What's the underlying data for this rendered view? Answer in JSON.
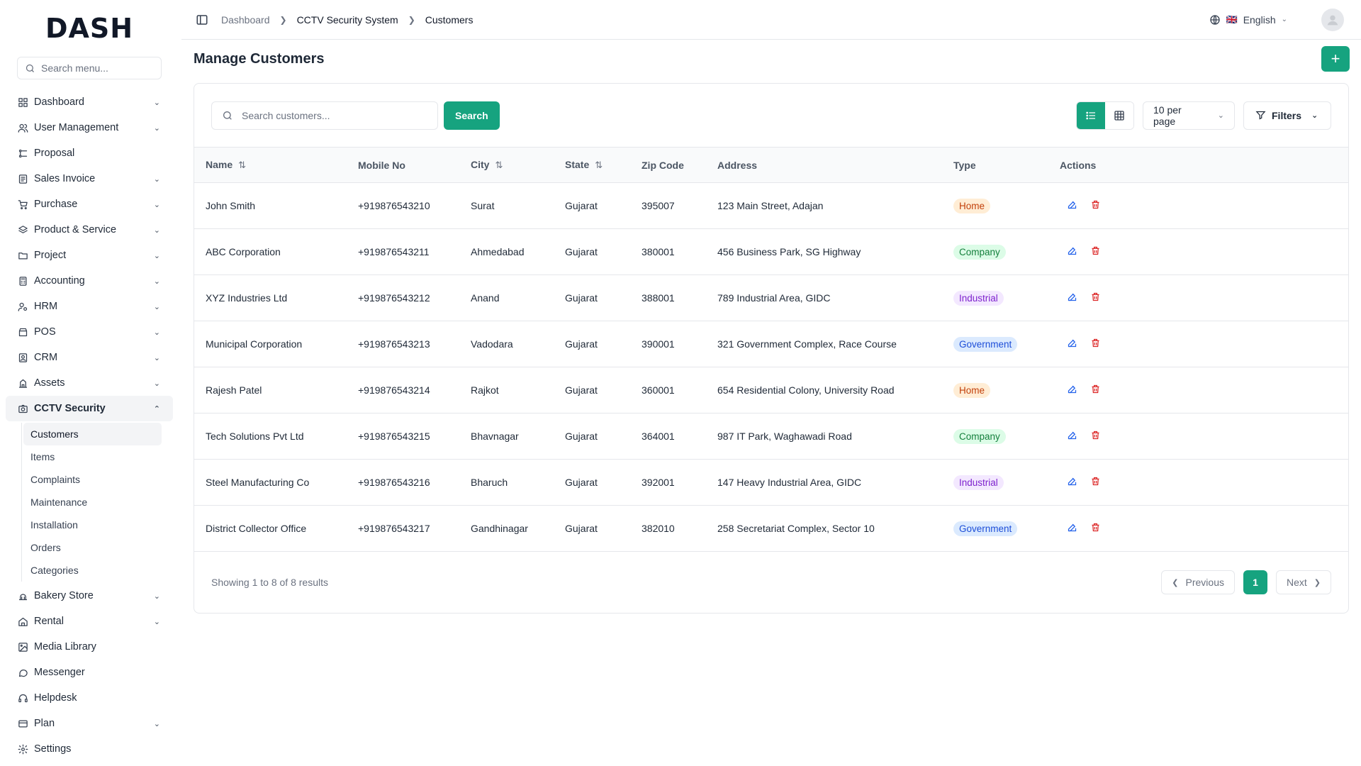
{
  "brand": {
    "logo": "DASH"
  },
  "sidebar": {
    "search_placeholder": "Search menu...",
    "items": [
      {
        "label": "Dashboard",
        "icon": "grid-icon",
        "chevron": true
      },
      {
        "label": "User Management",
        "icon": "users-icon",
        "chevron": true
      },
      {
        "label": "Proposal",
        "icon": "proposal-icon",
        "chevron": false
      },
      {
        "label": "Sales Invoice",
        "icon": "invoice-icon",
        "chevron": true
      },
      {
        "label": "Purchase",
        "icon": "cart-icon",
        "chevron": true
      },
      {
        "label": "Product & Service",
        "icon": "layers-icon",
        "chevron": true
      },
      {
        "label": "Project",
        "icon": "folder-icon",
        "chevron": true
      },
      {
        "label": "Accounting",
        "icon": "calculator-icon",
        "chevron": true
      },
      {
        "label": "HRM",
        "icon": "user-cog-icon",
        "chevron": true
      },
      {
        "label": "POS",
        "icon": "store-icon",
        "chevron": true
      },
      {
        "label": "CRM",
        "icon": "crm-icon",
        "chevron": true
      },
      {
        "label": "Assets",
        "icon": "assets-icon",
        "chevron": true
      },
      {
        "label": "CCTV Security",
        "icon": "camera-icon",
        "chevron": true,
        "active": true
      }
    ],
    "cctv_sub": [
      "Customers",
      "Items",
      "Complaints",
      "Maintenance",
      "Installation",
      "Orders",
      "Categories"
    ],
    "items_after": [
      {
        "label": "Bakery Store",
        "icon": "bakery-icon",
        "chevron": true
      },
      {
        "label": "Rental",
        "icon": "home-icon",
        "chevron": true
      },
      {
        "label": "Media Library",
        "icon": "image-icon",
        "chevron": false
      },
      {
        "label": "Messenger",
        "icon": "message-icon",
        "chevron": false
      },
      {
        "label": "Helpdesk",
        "icon": "headset-icon",
        "chevron": false
      },
      {
        "label": "Plan",
        "icon": "card-icon",
        "chevron": true
      },
      {
        "label": "Settings",
        "icon": "settings-icon",
        "chevron": false
      }
    ]
  },
  "header": {
    "breadcrumb": [
      "Dashboard",
      "CCTV Security System",
      "Customers"
    ],
    "language": "English",
    "flag": "🇬🇧"
  },
  "page": {
    "title": "Manage Customers"
  },
  "toolbar": {
    "search_placeholder": "Search customers...",
    "search_label": "Search",
    "per_page": "10 per page",
    "filters_label": "Filters"
  },
  "table": {
    "columns": [
      "Name",
      "Mobile No",
      "City",
      "State",
      "Zip Code",
      "Address",
      "Type",
      "Actions"
    ],
    "rows": [
      {
        "name": "John Smith",
        "mobile": "+919876543210",
        "city": "Surat",
        "state": "Gujarat",
        "zip": "395007",
        "address": "123 Main Street, Adajan",
        "type": "Home"
      },
      {
        "name": "ABC Corporation",
        "mobile": "+919876543211",
        "city": "Ahmedabad",
        "state": "Gujarat",
        "zip": "380001",
        "address": "456 Business Park, SG Highway",
        "type": "Company"
      },
      {
        "name": "XYZ Industries Ltd",
        "mobile": "+919876543212",
        "city": "Anand",
        "state": "Gujarat",
        "zip": "388001",
        "address": "789 Industrial Area, GIDC",
        "type": "Industrial"
      },
      {
        "name": "Municipal Corporation",
        "mobile": "+919876543213",
        "city": "Vadodara",
        "state": "Gujarat",
        "zip": "390001",
        "address": "321 Government Complex, Race Course",
        "type": "Government"
      },
      {
        "name": "Rajesh Patel",
        "mobile": "+919876543214",
        "city": "Rajkot",
        "state": "Gujarat",
        "zip": "360001",
        "address": "654 Residential Colony, University Road",
        "type": "Home"
      },
      {
        "name": "Tech Solutions Pvt Ltd",
        "mobile": "+919876543215",
        "city": "Bhavnagar",
        "state": "Gujarat",
        "zip": "364001",
        "address": "987 IT Park, Waghawadi Road",
        "type": "Company"
      },
      {
        "name": "Steel Manufacturing Co",
        "mobile": "+919876543216",
        "city": "Bharuch",
        "state": "Gujarat",
        "zip": "392001",
        "address": "147 Heavy Industrial Area, GIDC",
        "type": "Industrial"
      },
      {
        "name": "District Collector Office",
        "mobile": "+919876543217",
        "city": "Gandhinagar",
        "state": "Gujarat",
        "zip": "382010",
        "address": "258 Secretariat Complex, Sector 10",
        "type": "Government"
      }
    ]
  },
  "footer": {
    "info": "Showing 1 to 8 of 8 results",
    "prev": "Previous",
    "next": "Next",
    "current_page": "1"
  },
  "colors": {
    "accent": "#16a37f"
  }
}
